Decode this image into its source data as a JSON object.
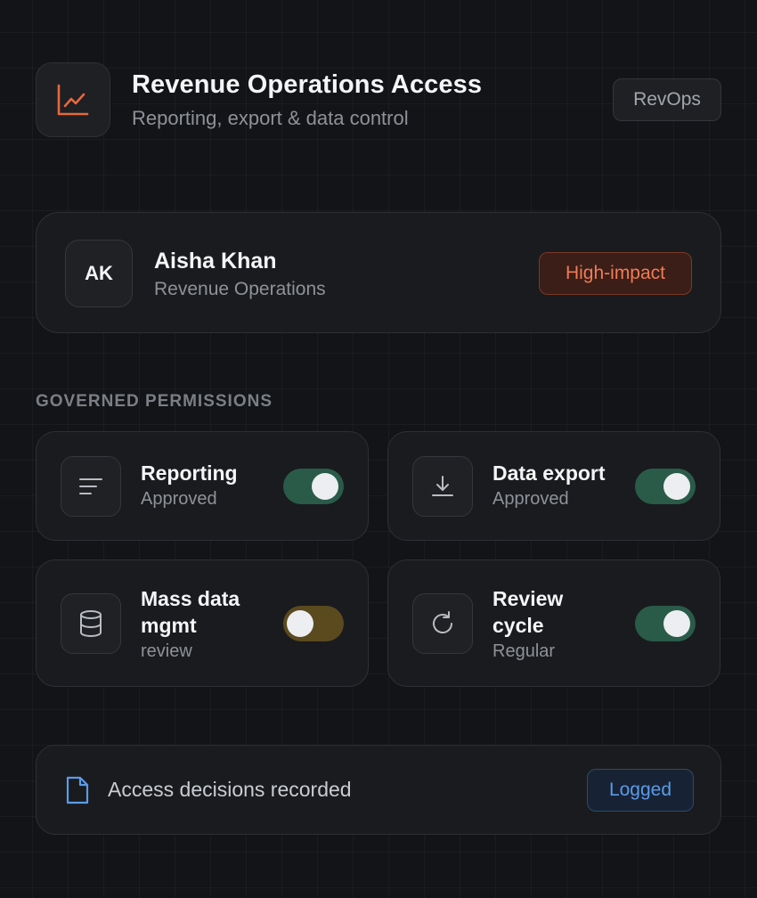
{
  "header": {
    "title": "Revenue Operations Access",
    "subtitle": "Reporting, export & data control",
    "tag": "RevOps",
    "icon": "line-chart-icon",
    "accent_color": "#e8673d"
  },
  "user": {
    "initials": "AK",
    "name": "Aisha Khan",
    "department": "Revenue Operations",
    "badge": "High-impact"
  },
  "permissions": {
    "section_label": "GOVERNED PERMISSIONS",
    "items": [
      {
        "name": "Reporting",
        "status": "Approved",
        "icon": "list-lines-icon",
        "enabled": true,
        "state": "on"
      },
      {
        "name": "Data export",
        "status": "Approved",
        "icon": "download-icon",
        "enabled": true,
        "state": "on"
      },
      {
        "name_line1": "Mass data",
        "name_line2": "mgmt",
        "status": "review",
        "icon": "database-icon",
        "enabled": false,
        "state": "review"
      },
      {
        "name_line1": "Review",
        "name_line2": "cycle",
        "status": "Regular",
        "icon": "refresh-icon",
        "enabled": true,
        "state": "on"
      }
    ]
  },
  "log": {
    "text": "Access decisions recorded",
    "badge": "Logged",
    "icon": "document-icon"
  },
  "colors": {
    "toggle_on": "#2a5b48",
    "toggle_review": "#5a4a1e",
    "impact": "#f07b56",
    "logged": "#5b9be8"
  }
}
